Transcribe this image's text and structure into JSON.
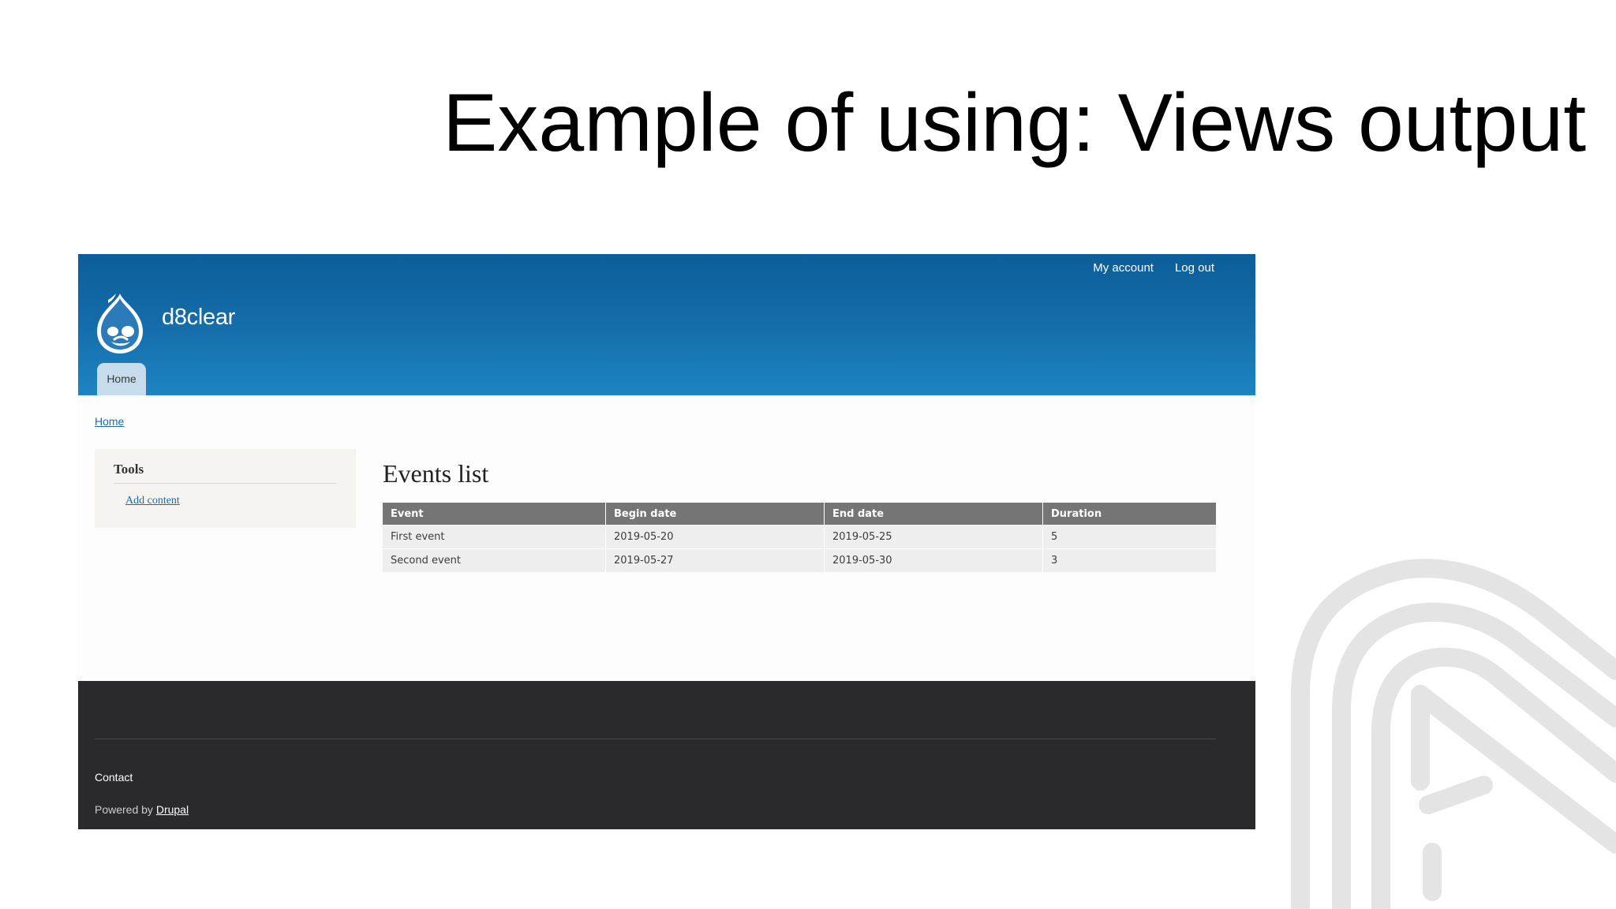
{
  "slide": {
    "title": "Example of using: Views output"
  },
  "header": {
    "secondary_menu": [
      "My account",
      "Log out"
    ],
    "site_name": "d8clear",
    "main_menu": [
      "Home"
    ]
  },
  "breadcrumb": [
    "Home"
  ],
  "sidebar": {
    "title": "Tools",
    "links": [
      "Add content"
    ]
  },
  "content": {
    "title": "Events list",
    "table": {
      "columns": [
        "Event",
        "Begin date",
        "End date",
        "Duration"
      ],
      "rows": [
        [
          "First event",
          "2019-05-20",
          "2019-05-25",
          "5"
        ],
        [
          "Second event",
          "2019-05-27",
          "2019-05-30",
          "3"
        ]
      ]
    }
  },
  "footer": {
    "links": [
      "Contact"
    ],
    "powered_by_prefix": "Powered by ",
    "powered_by_link": "Drupal"
  },
  "colors": {
    "header_top": "#0c5e98",
    "header_bottom": "#1d84c2",
    "footer_bg": "#2a292b",
    "table_header_bg": "#757575",
    "link": "#1e6aa8"
  },
  "icons": {
    "logo": "drupal-drop-logo-icon",
    "decoration": "brand-watermark-icon"
  }
}
